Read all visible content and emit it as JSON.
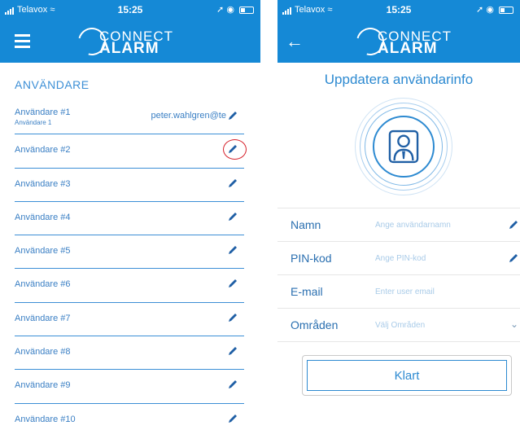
{
  "status_bar": {
    "carrier": "Telavox",
    "time": "15:25"
  },
  "brand": {
    "connect": "CONNECT",
    "alarm": "ALARM"
  },
  "colors": {
    "header": "#1589d6",
    "accent": "#3c8fd6",
    "highlight": "#d6202a"
  },
  "users_screen": {
    "section_title": "ANVÄNDARE",
    "menu_icon": "hamburger-menu-icon",
    "users": [
      {
        "name": "Användare #1",
        "sub": "Användare 1",
        "email": "peter.wahlgren@te"
      },
      {
        "name": "Användare #2"
      },
      {
        "name": "Användare #3"
      },
      {
        "name": "Användare #4"
      },
      {
        "name": "Användare #5"
      },
      {
        "name": "Användare #6"
      },
      {
        "name": "Användare #7"
      },
      {
        "name": "Användare #8"
      },
      {
        "name": "Användare #9"
      },
      {
        "name": "Användare #10"
      }
    ]
  },
  "edit_screen": {
    "back_icon": "back-arrow-icon",
    "title": "Uppdatera användarinfo",
    "fields": [
      {
        "label": "Namn",
        "placeholder": "Ange användarnamn",
        "icon": "pencil-icon"
      },
      {
        "label": "PIN-kod",
        "placeholder": "Ange PIN-kod",
        "icon": "pencil-icon"
      },
      {
        "label": "E-mail",
        "placeholder": "Enter user email",
        "icon": ""
      },
      {
        "label": "Områden",
        "placeholder": "Välj Områden",
        "icon": "chevron-down-icon"
      }
    ],
    "done_label": "Klart"
  }
}
